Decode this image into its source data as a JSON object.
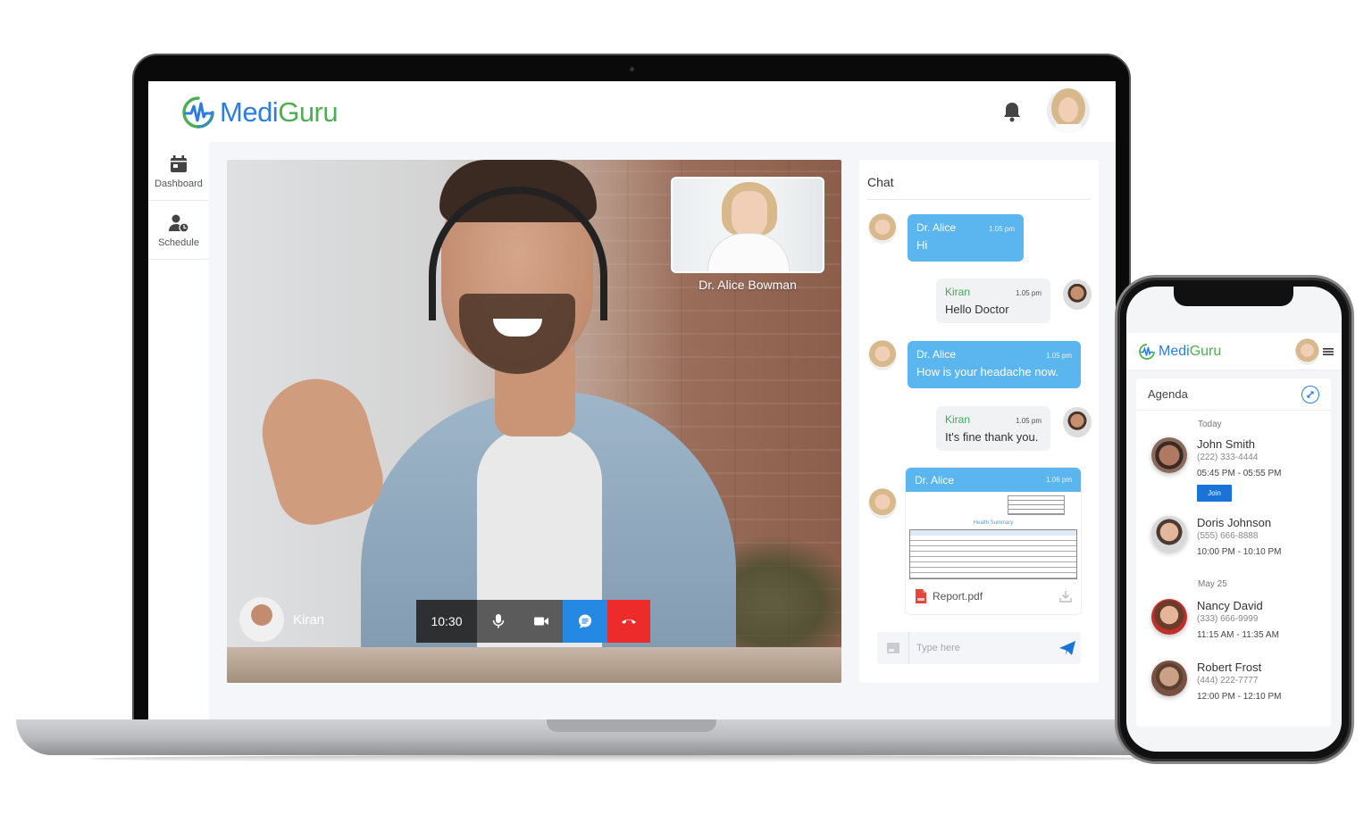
{
  "app": {
    "brand_part1": "Medi",
    "brand_part2": "Guru",
    "colors": {
      "brand_blue": "#2b7de3",
      "brand_green": "#4caf50",
      "chat_blue": "#5bb5ef",
      "end_call_red": "#ee2b2b",
      "chat_button_blue": "#2588e3"
    }
  },
  "header": {
    "notification_icon": "bell-icon",
    "user_avatar": "Dr. Alice Bowman"
  },
  "sidebar": {
    "items": [
      {
        "label": "Dashboard",
        "icon": "calendar-icon"
      },
      {
        "label": "Schedule",
        "icon": "user-clock-icon"
      }
    ]
  },
  "video_call": {
    "remote_name": "Dr. Alice Bowman",
    "local_name": "Kiran",
    "timer": "10:30",
    "controls": [
      "microphone-icon",
      "video-camera-icon",
      "chat-icon",
      "end-call-icon"
    ]
  },
  "chat": {
    "title": "Chat",
    "messages": [
      {
        "sender": "Dr. Alice",
        "time": "1.05 pm",
        "text": "Hi",
        "side": "incoming"
      },
      {
        "sender": "Kiran",
        "time": "1.05 pm",
        "text": "Hello Doctor",
        "side": "outgoing"
      },
      {
        "sender": "Dr. Alice",
        "time": "1.05 pm",
        "text": "How is your headache now.",
        "side": "incoming"
      },
      {
        "sender": "Kiran",
        "time": "1.05 pm",
        "text": "It's fine thank you.",
        "side": "outgoing"
      },
      {
        "sender": "Dr. Alice",
        "time": "1.06 pm",
        "attachment": {
          "preview_title": "Health Summary",
          "file_name": "Report.pdf"
        },
        "side": "incoming"
      }
    ],
    "input": {
      "placeholder": "Type here",
      "value": ""
    }
  },
  "mobile": {
    "brand_part1": "Medi",
    "brand_part2": "Guru",
    "agenda": {
      "title": "Agenda",
      "groups": [
        {
          "day": "Today",
          "appointments": [
            {
              "name": "John Smith",
              "phone": "(222) 333-4444",
              "time": "05:45 PM - 05:55 PM",
              "action": "Join"
            },
            {
              "name": "Doris Johnson",
              "phone": "(555) 666-8888",
              "time": "10:00 PM - 10:10 PM"
            }
          ]
        },
        {
          "day": "May 25",
          "appointments": [
            {
              "name": "Nancy David",
              "phone": "(333) 666-9999",
              "time": "11:15 AM - 11:35 AM"
            },
            {
              "name": "Robert Frost",
              "phone": "(444) 222-7777",
              "time": "12:00 PM - 12:10 PM"
            }
          ]
        }
      ]
    }
  }
}
